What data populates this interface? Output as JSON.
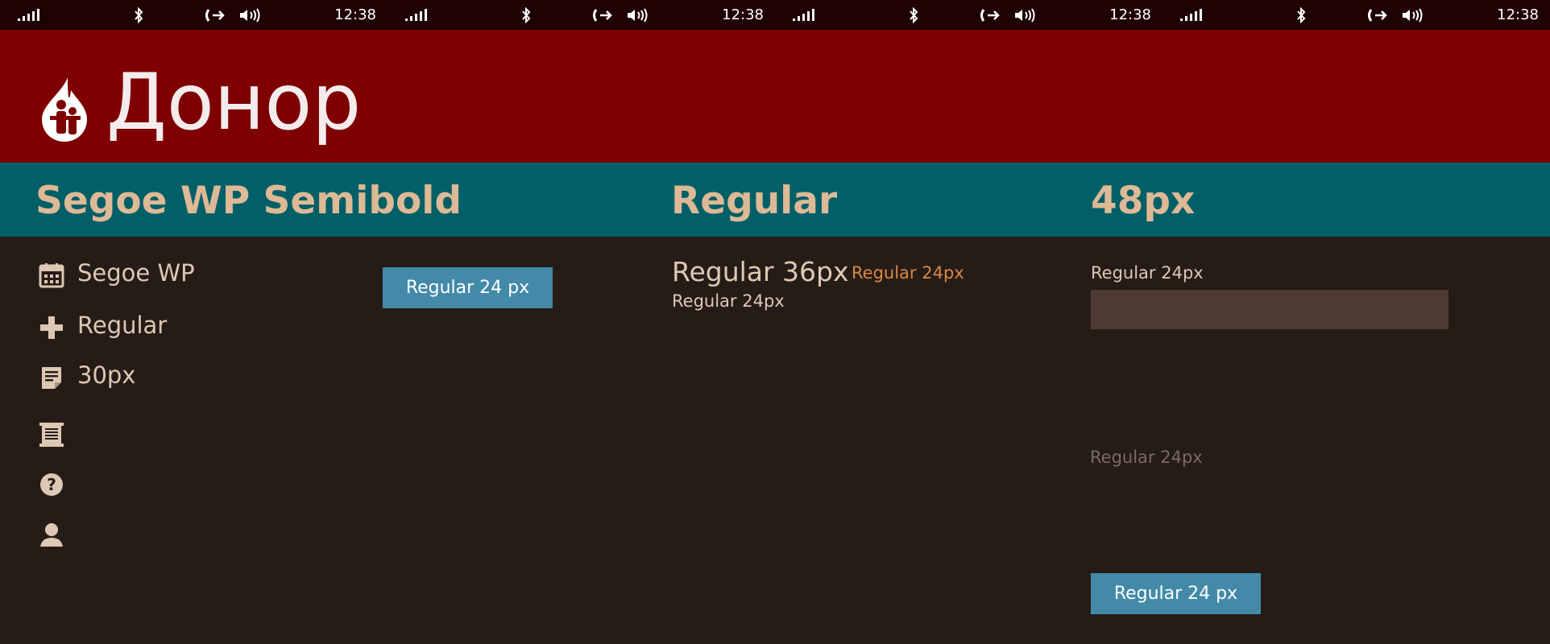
{
  "status_bar": {
    "time": "12:38",
    "icons": [
      "signal-strength-icon",
      "bluetooth-icon",
      "call-forwarding-icon",
      "volume-icon"
    ]
  },
  "header": {
    "title": "Донор",
    "logo_icon": "blood-drop-people-logo"
  },
  "subheader": {
    "col1": "Segoe WP Semibold",
    "col2": "Regular",
    "col3": "48px"
  },
  "nav": {
    "items": [
      {
        "icon": "calendar-icon",
        "label": "Segoe WP"
      },
      {
        "icon": "plus-icon",
        "label": "Regular"
      },
      {
        "icon": "note-icon",
        "label": "30px"
      },
      {
        "icon": "receipt-icon",
        "label": ""
      },
      {
        "icon": "help-icon",
        "label": ""
      },
      {
        "icon": "person-icon",
        "label": ""
      }
    ]
  },
  "left_button": {
    "label": "Regular 24 px"
  },
  "middle": {
    "large": "Regular 36px",
    "accent": "Regular 24px",
    "small": "Regular 24px"
  },
  "right": {
    "label": "Regular 24px",
    "input_value": "",
    "disabled_text": "Regular 24px",
    "button_label": "Regular 24 px"
  },
  "colors": {
    "status_bar_bg": "#1f0203",
    "header_bg": "#7e0000",
    "subheader_bg": "#005f67",
    "body_bg": "#261c17",
    "accent_text": "#d98744",
    "button_bg": "#438aa8",
    "input_bg": "#4e3a33",
    "heading_text": "#ddb996",
    "body_text": "#ddc8b4"
  }
}
